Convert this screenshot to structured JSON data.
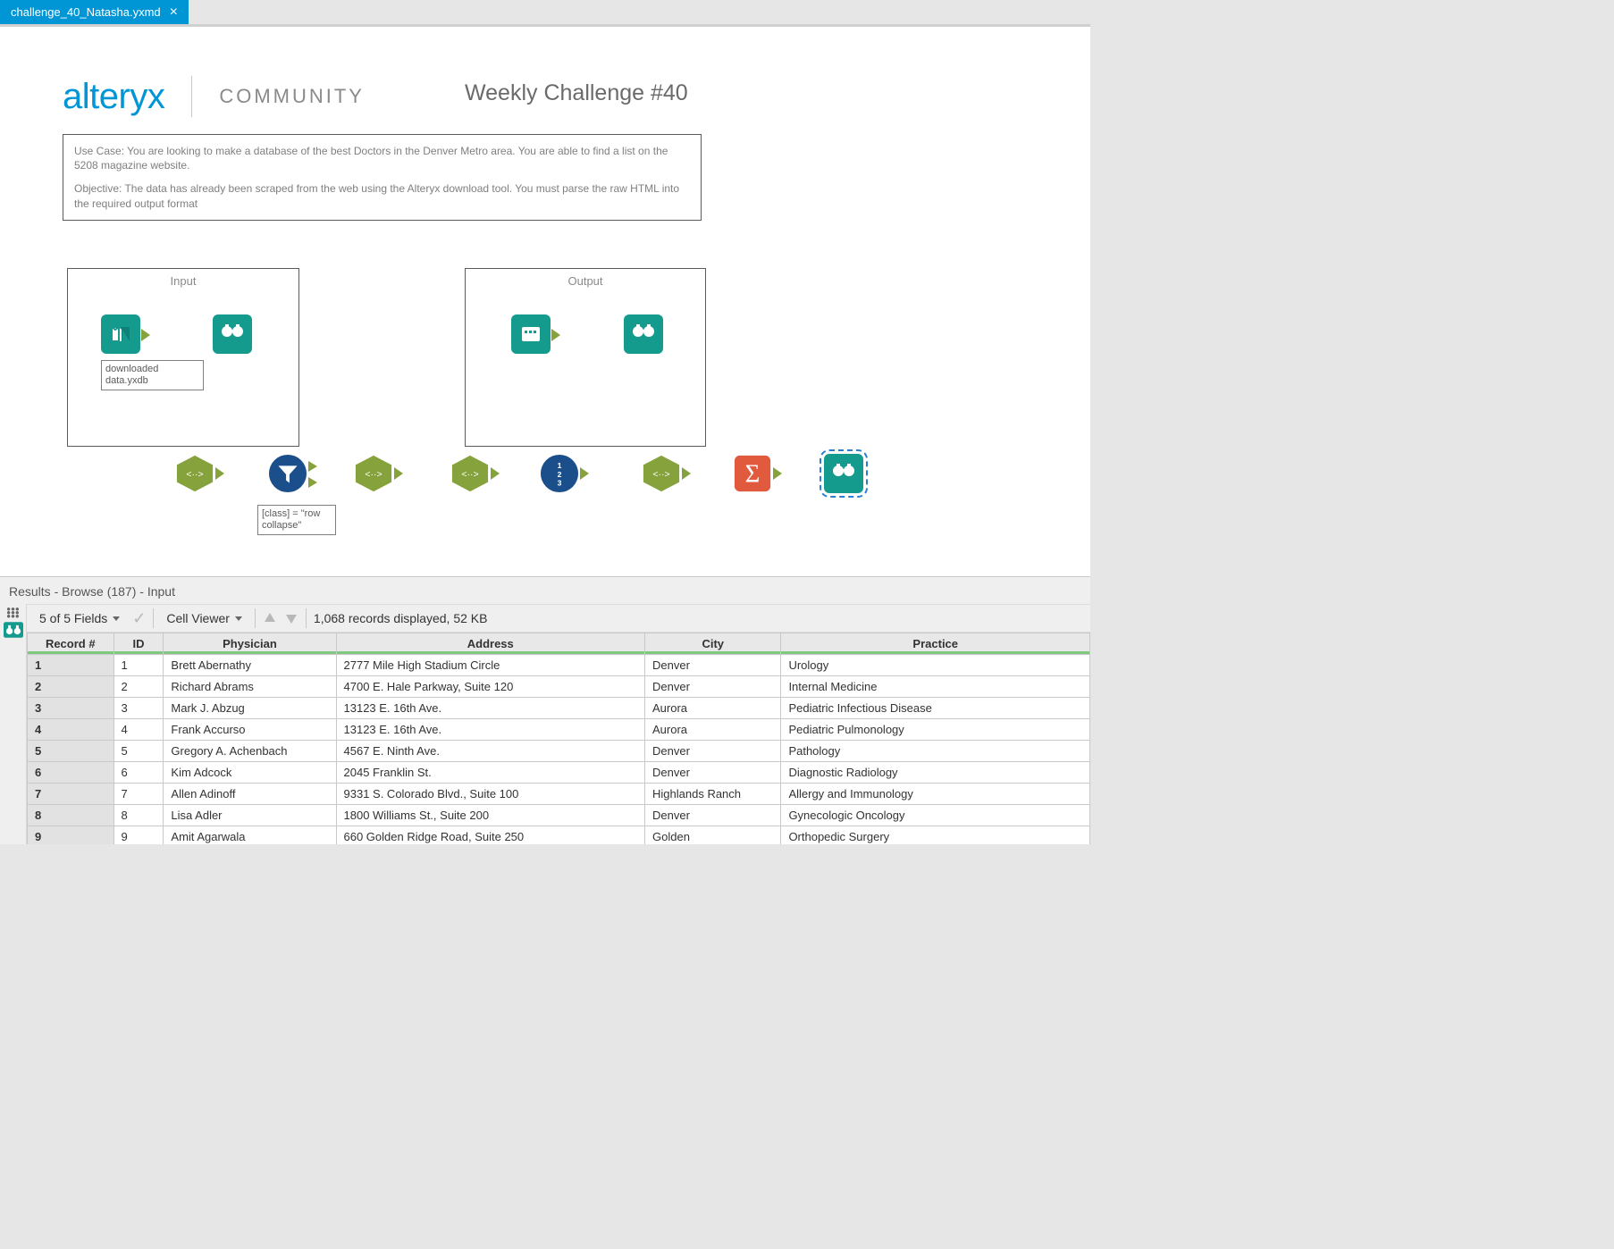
{
  "tab": {
    "title": "challenge_40_Natasha.yxmd"
  },
  "header": {
    "logo": "alteryx",
    "community": "COMMUNITY",
    "title": "Weekly Challenge #40"
  },
  "description": {
    "p1": "Use Case:  You are looking to make a database of the best Doctors in the Denver Metro area.   You are able to find a list on the 5208 magazine website.",
    "p2": "Objective:  The data has already been scraped from the web using the Alteryx download tool.  You must parse the raw HTML into the required output format"
  },
  "containers": {
    "input": "Input",
    "output": "Output"
  },
  "annotations": {
    "input_file": "downloaded data.yxdb",
    "filter": "[class] = \"row collapse\""
  },
  "results": {
    "header": "Results - Browse (187) - Input",
    "fields": "5 of 5 Fields",
    "cell_viewer": "Cell Viewer",
    "status": "1,068 records displayed, 52 KB",
    "columns": [
      "Record #",
      "ID",
      "Physician",
      "Address",
      "City",
      "Practice"
    ],
    "rows": [
      {
        "rec": "1",
        "id": "1",
        "physician": "Brett Abernathy",
        "address": "2777 Mile High Stadium Circle",
        "city": "Denver",
        "practice": "Urology"
      },
      {
        "rec": "2",
        "id": "2",
        "physician": "Richard Abrams",
        "address": "4700 E. Hale Parkway, Suite 120",
        "city": "Denver",
        "practice": "Internal Medicine"
      },
      {
        "rec": "3",
        "id": "3",
        "physician": "Mark J. Abzug",
        "address": "13123 E. 16th Ave.",
        "city": "Aurora",
        "practice": "Pediatric Infectious Disease"
      },
      {
        "rec": "4",
        "id": "4",
        "physician": "Frank Accurso",
        "address": "13123 E. 16th Ave.",
        "city": "Aurora",
        "practice": "Pediatric Pulmonology"
      },
      {
        "rec": "5",
        "id": "5",
        "physician": "Gregory A. Achenbach",
        "address": "4567 E. Ninth Ave.",
        "city": "Denver",
        "practice": "Pathology"
      },
      {
        "rec": "6",
        "id": "6",
        "physician": "Kim Adcock",
        "address": "2045 Franklin St.",
        "city": "Denver",
        "practice": "Diagnostic Radiology"
      },
      {
        "rec": "7",
        "id": "7",
        "physician": "Allen Adinoff",
        "address": "9331 S. Colorado Blvd., Suite 100",
        "city": "Highlands Ranch",
        "practice": "Allergy and Immunology"
      },
      {
        "rec": "8",
        "id": "8",
        "physician": "Lisa Adler",
        "address": "1800 Williams St., Suite 200",
        "city": "Denver",
        "practice": "Gynecologic Oncology"
      },
      {
        "rec": "9",
        "id": "9",
        "physician": "Amit Agarwala",
        "address": "660 Golden Ridge Road, Suite 250",
        "city": "Golden",
        "practice": "Orthopedic Surgery"
      }
    ]
  }
}
